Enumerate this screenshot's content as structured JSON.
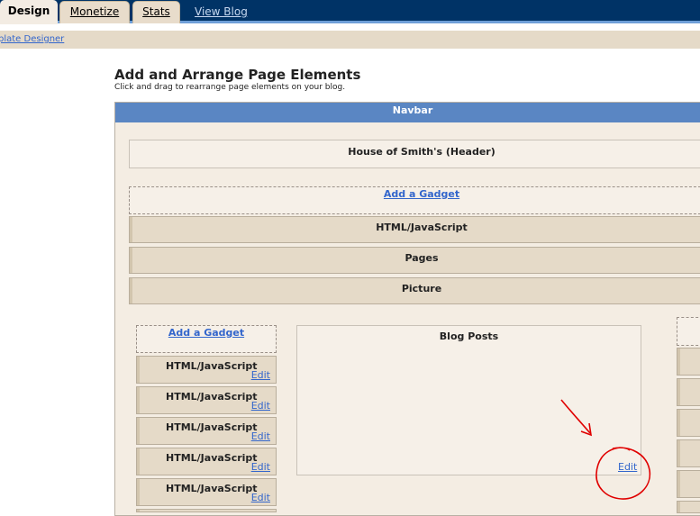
{
  "tabs": [
    {
      "label": "Design",
      "active": true
    },
    {
      "label": "Monetize",
      "active": false
    },
    {
      "label": "Stats",
      "active": false
    }
  ],
  "top_link": "View Blog",
  "subnav_link": "plate Designer",
  "page": {
    "title": "Add and Arrange Page Elements",
    "subtitle": "Click and drag to rearrange page elements on your blog."
  },
  "layout": {
    "navbar": "Navbar",
    "header": "House of Smith's (Header)",
    "add_gadget": "Add a Gadget",
    "top_gadgets": [
      "HTML/JavaScript",
      "Pages",
      "Picture"
    ],
    "sidebar_add_gadget": "Add a Gadget",
    "sidebar_gadgets": [
      {
        "label": "HTML/JavaScript",
        "edit": "Edit"
      },
      {
        "label": "HTML/JavaScript",
        "edit": "Edit"
      },
      {
        "label": "HTML/JavaScript",
        "edit": "Edit"
      },
      {
        "label": "HTML/JavaScript",
        "edit": "Edit"
      },
      {
        "label": "HTML/JavaScript",
        "edit": "Edit"
      }
    ],
    "blog_posts": {
      "label": "Blog Posts",
      "edit": "Edit"
    }
  },
  "colors": {
    "topbar": "#003366",
    "annotation": "#e00000",
    "link": "#3366cc",
    "navbar": "#5a86c3"
  }
}
